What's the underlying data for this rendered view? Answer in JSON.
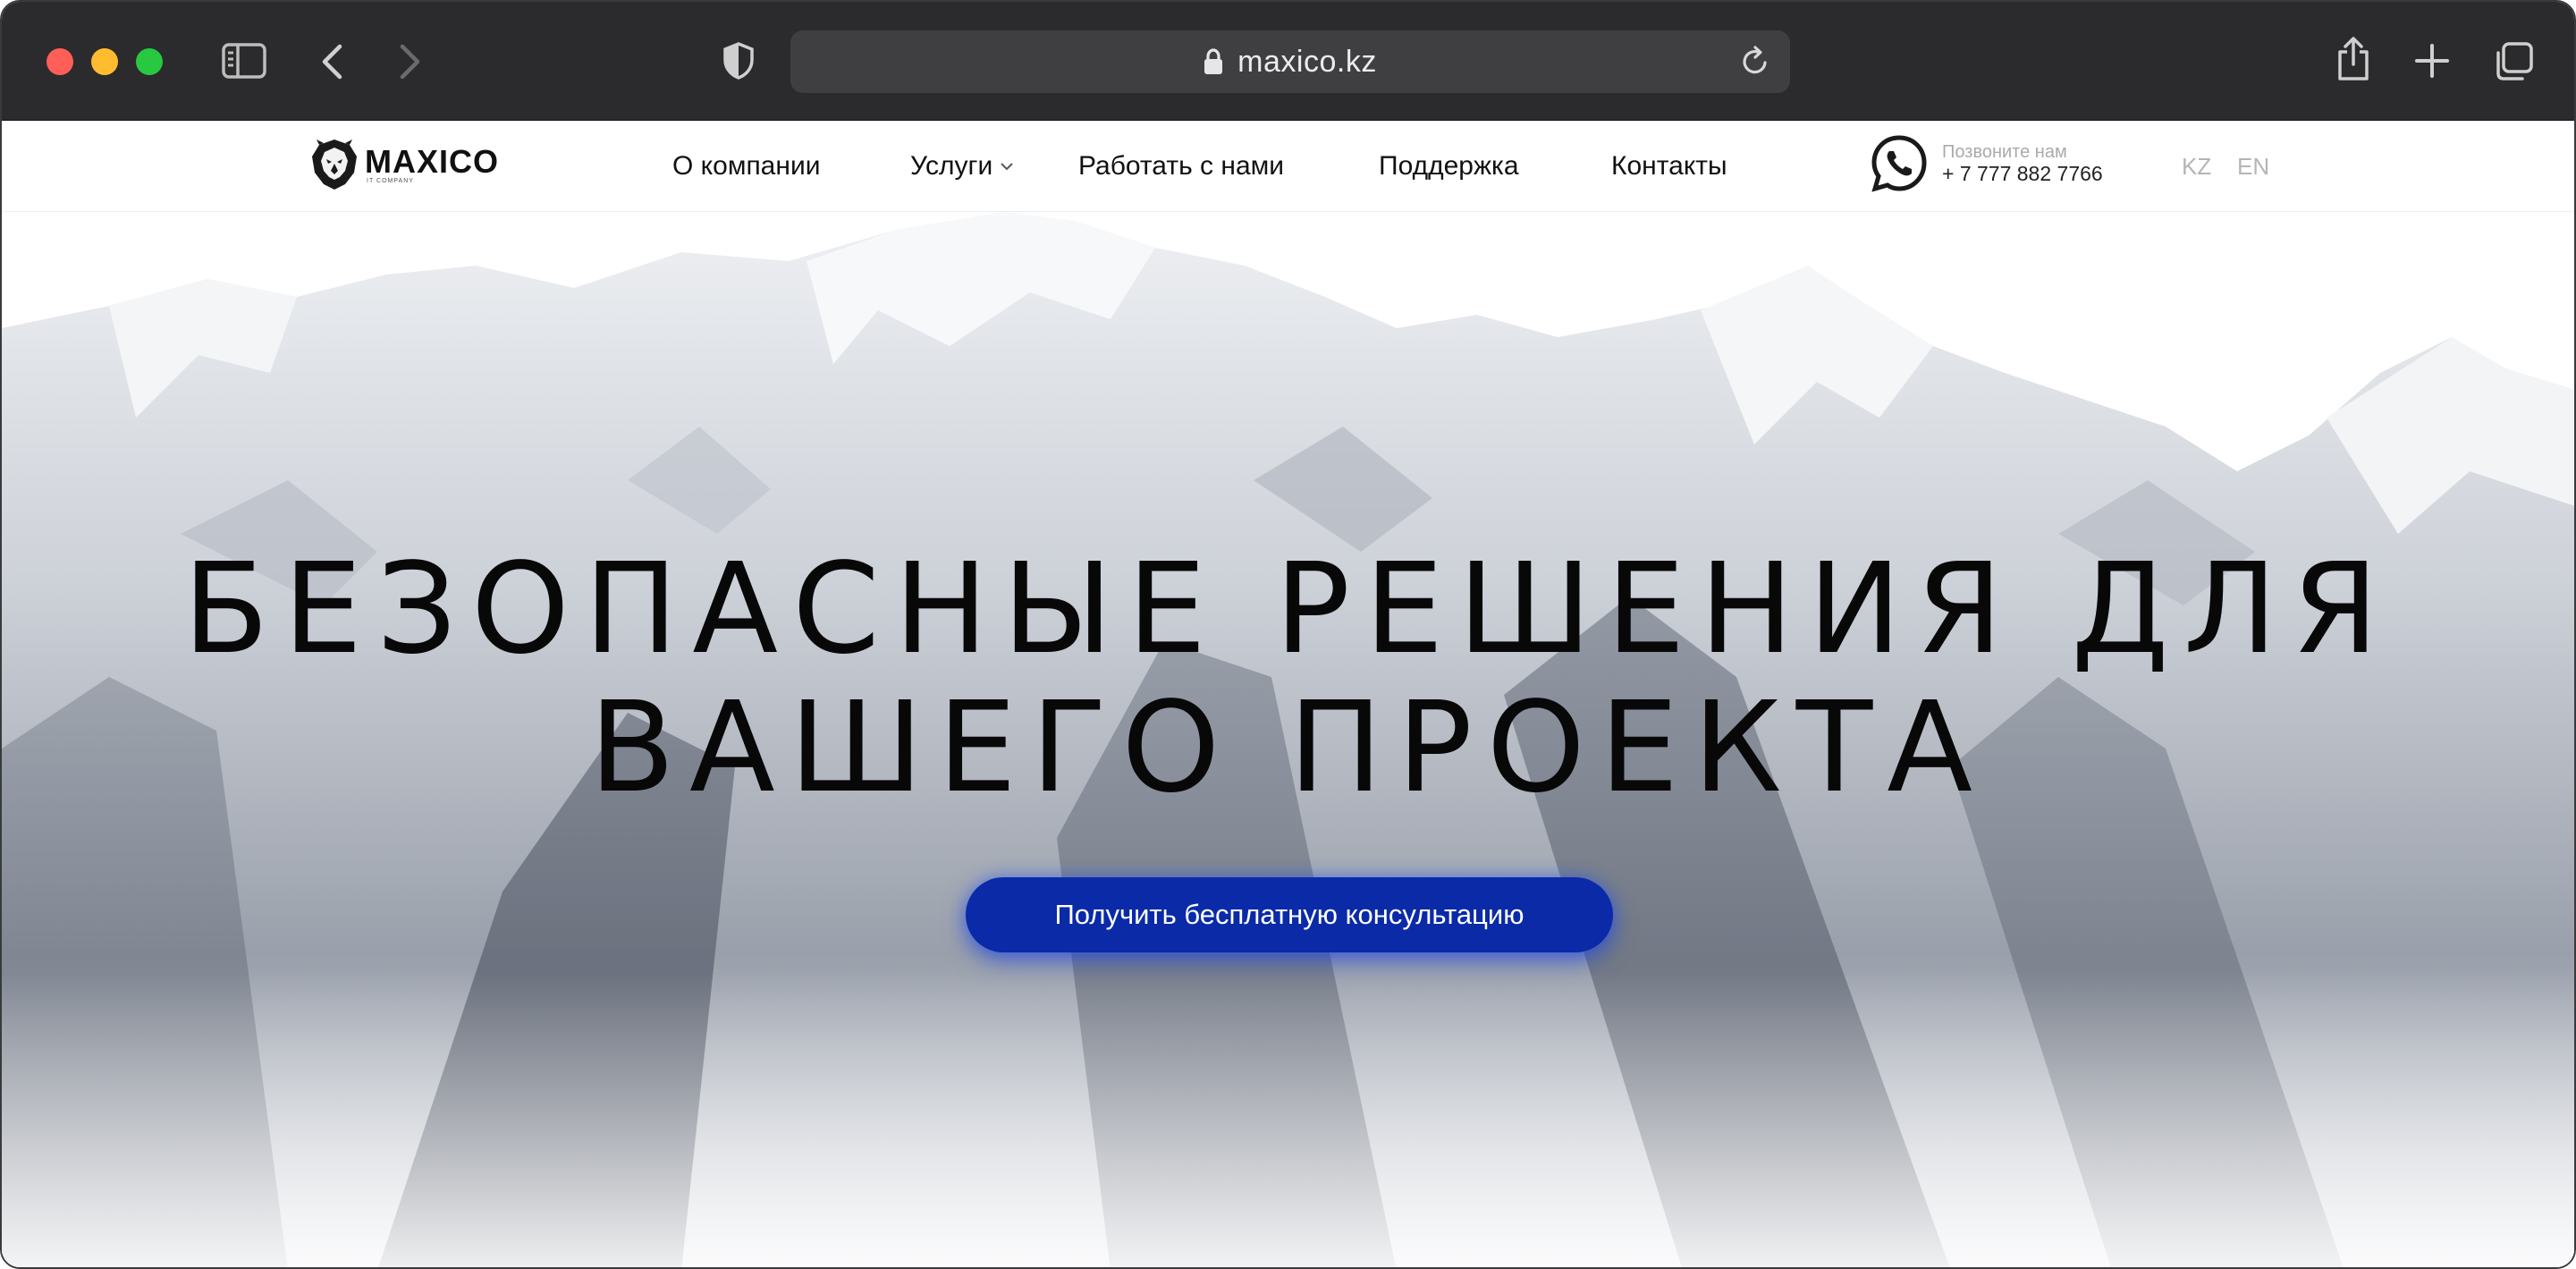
{
  "browser": {
    "url": "maxico.kz"
  },
  "header": {
    "logo": {
      "name": "MAXICO",
      "subtitle": "IT COMPANY"
    },
    "nav": [
      {
        "label": "О компании"
      },
      {
        "label": "Услуги",
        "has_dropdown": true
      },
      {
        "label": "Работать с нами"
      },
      {
        "label": "Поддержка"
      },
      {
        "label": "Контакты"
      }
    ],
    "contact": {
      "label": "Позвоните нам",
      "phone": "+ 7 777 882 7766",
      "icon": "whatsapp-icon"
    },
    "languages": [
      "KZ",
      "EN"
    ]
  },
  "hero": {
    "headline_line1": "БЕЗОПАСНЫЕ РЕШЕНИЯ ДЛЯ",
    "headline_line2": "ВАШЕГО ПРОЕКТА",
    "cta_label": "Получить бесплатную консультацию"
  },
  "colors": {
    "chrome_bg": "#2b2b2d",
    "accent": "#0a2aa8",
    "headline": "#080808"
  }
}
